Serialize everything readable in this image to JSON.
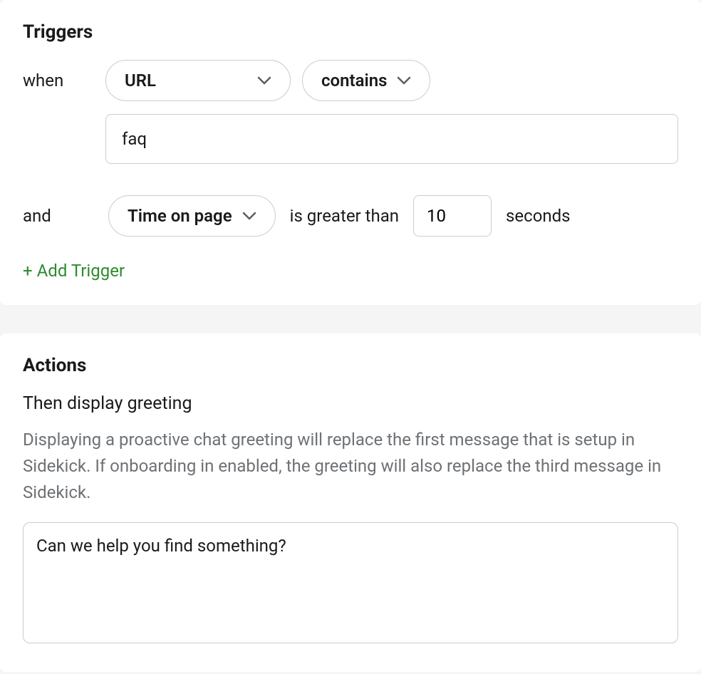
{
  "triggers": {
    "title": "Triggers",
    "when_label": "when",
    "row1": {
      "field_select": "URL",
      "match_select": "contains"
    },
    "value_input": "faq",
    "row2": {
      "and_label": "and",
      "metric_select": "Time on page",
      "comparison_text": "is greater than",
      "number_value": "10",
      "unit_text": "seconds"
    },
    "add_trigger_label": "Add Trigger"
  },
  "actions": {
    "title": "Actions",
    "subtitle": "Then display greeting",
    "description": "Displaying a proactive chat greeting will replace the first message that is setup in Sidekick. If onboarding in enabled, the greeting will also replace the third message in Sidekick.",
    "greeting_value": "Can we help you find something?"
  }
}
